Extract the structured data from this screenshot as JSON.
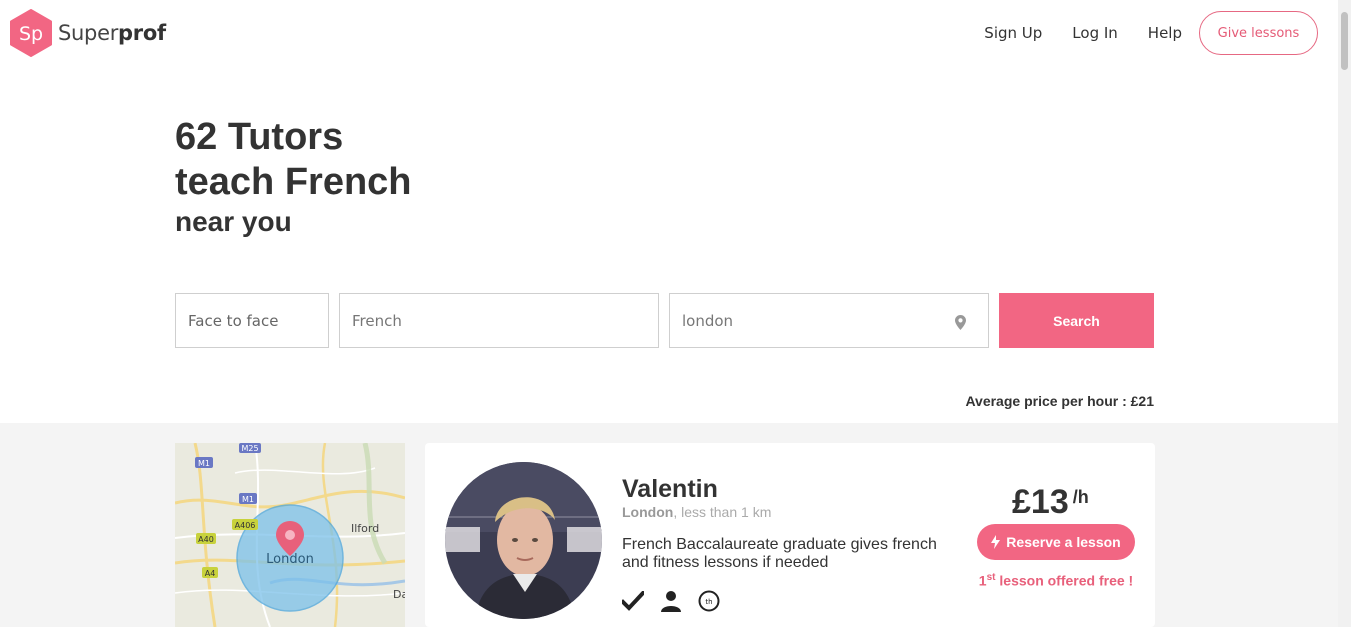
{
  "header": {
    "logo_badge": "Sp",
    "logo_text_light": "Super",
    "logo_text_bold": "prof",
    "nav": {
      "signup": "Sign Up",
      "login": "Log In",
      "help": "Help"
    },
    "give_lessons": "Give lessons"
  },
  "hero": {
    "line1": "62 Tutors",
    "line2": "teach French",
    "line3": "near you"
  },
  "search": {
    "mode": "Face to face",
    "subject": "French",
    "city": "london",
    "button": "Search"
  },
  "average_price": "Average price per hour : £21",
  "map": {
    "city_label": "London",
    "road_labels": [
      "M1",
      "M25",
      "M1",
      "A406",
      "A40",
      "A4",
      "Ilford",
      "Da"
    ]
  },
  "tutor": {
    "name": "Valentin",
    "location_city": "London",
    "location_distance": ", less than 1 km",
    "description": "French Baccalaureate graduate gives french and fitness lessons if needed",
    "price": "£13",
    "price_unit": "/h",
    "reserve": "Reserve a lesson",
    "free_num": "1",
    "free_sup": "st",
    "free_text": " lesson offered free !"
  },
  "colors": {
    "brand": "#f26683",
    "brand_dark": "#e55a76",
    "band": "#f4f4f4"
  },
  "icons": [
    "logo-hexagon-icon",
    "map-pin-icon",
    "lightning-icon",
    "checkmark-icon",
    "person-icon",
    "ambassador-badge-icon"
  ]
}
